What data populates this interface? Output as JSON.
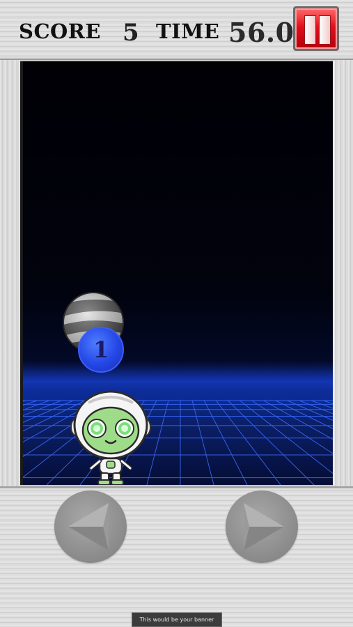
{
  "hud": {
    "score_label": "SCORE",
    "score_value": "5",
    "time_label": "TIME",
    "time_value": "56.0",
    "pause_icon": "pause-icon"
  },
  "game": {
    "coin_label": "1",
    "player_sprite": "robot-astronaut",
    "obstacle": "striped-ball"
  },
  "controls": {
    "left_icon": "left-arrow-icon",
    "right_icon": "right-arrow-icon"
  },
  "banner": {
    "text": "This would be your banner"
  },
  "colors": {
    "pause_button": "#e0101c",
    "coin": "#2447e6",
    "grid": "#2c5cff",
    "sky": "#000005"
  }
}
